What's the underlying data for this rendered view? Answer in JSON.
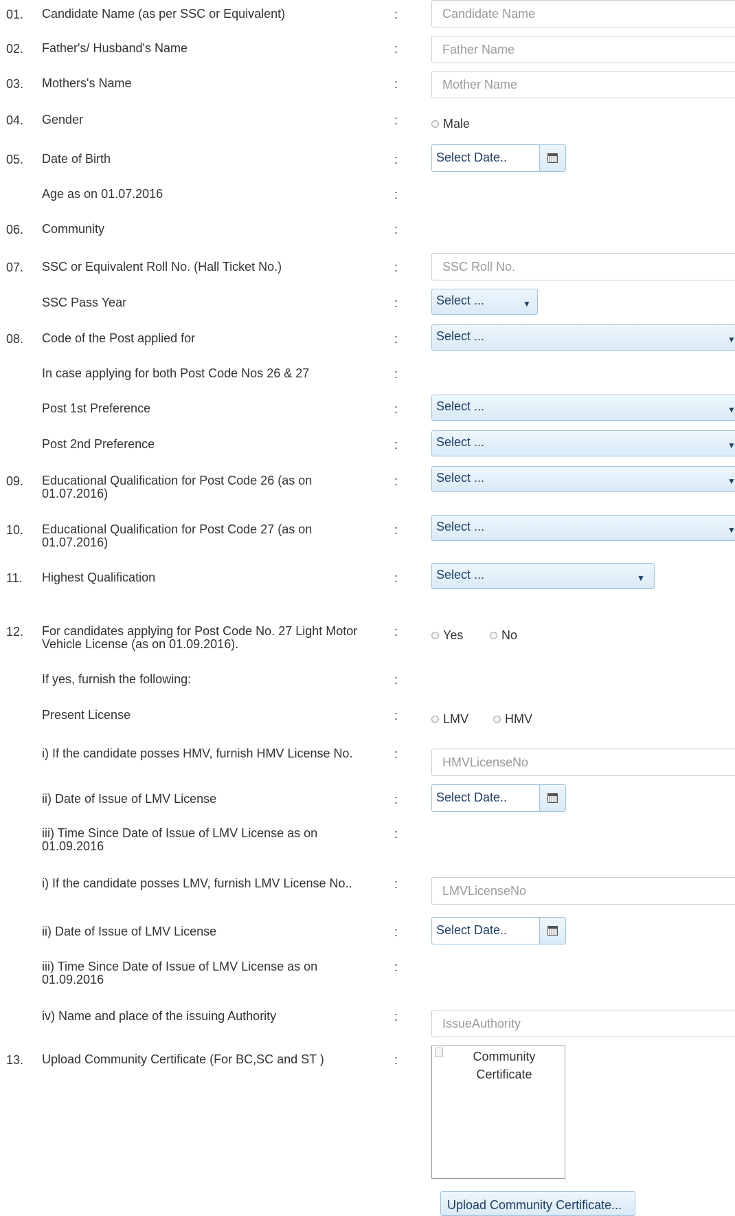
{
  "rows": {
    "r01": {
      "num": "01.",
      "label": "Candidate Name (as per SSC or Equivalent)",
      "placeholder": "Candidate Name"
    },
    "r02": {
      "num": "02.",
      "label": "Father's/ Husband's Name",
      "placeholder": "Father Name"
    },
    "r03": {
      "num": "03.",
      "label": "Mothers's Name",
      "placeholder": "Mother Name"
    },
    "r04": {
      "num": "04.",
      "label": "Gender",
      "option1": "Male"
    },
    "r05": {
      "num": "05.",
      "label": "Date of Birth",
      "value": "Select Date.."
    },
    "age": {
      "label": "Age as on 01.07.2016"
    },
    "r06": {
      "num": "06.",
      "label": "Community"
    },
    "r07": {
      "num": "07.",
      "label": "SSC or Equivalent Roll No. (Hall Ticket No.)",
      "placeholder": "SSC Roll No."
    },
    "ssc_year": {
      "label": "SSC Pass Year",
      "value": "Select ..."
    },
    "r08": {
      "num": "08.",
      "label": "Code of the Post applied for",
      "value": "Select ..."
    },
    "both": {
      "label": "In case applying for both Post Code Nos 26 & 27"
    },
    "pref1": {
      "label": "Post 1st Preference",
      "value": "Select ..."
    },
    "pref2": {
      "label": "Post 2nd Preference",
      "value": "Select ..."
    },
    "r09": {
      "num": "09.",
      "label": "Educational Qualification for Post Code 26 (as on 01.07.2016)",
      "value": "Select ..."
    },
    "r10": {
      "num": "10.",
      "label": "Educational Qualification for Post Code 27 (as on 01.07.2016)",
      "value": "Select ..."
    },
    "r11": {
      "num": "11.",
      "label": "Highest Qualification",
      "value": "Select ..."
    },
    "r12": {
      "num": "12.",
      "label": "For candidates applying for Post Code No. 27 Light Motor Vehicle License (as on 01.09.2016).",
      "option1": "Yes",
      "option2": "No"
    },
    "ifyes": {
      "label": "If yes, furnish the following:"
    },
    "present": {
      "label": "Present License",
      "option1": "LMV",
      "option2": "HMV"
    },
    "hmv_no": {
      "label": "i) If the candidate posses HMV, furnish HMV License No.",
      "placeholder": "HMVLicenseNo"
    },
    "hmv_date": {
      "label": "ii) Date of Issue of LMV License",
      "value": "Select Date.."
    },
    "hmv_time": {
      "label": "iii) Time Since Date of Issue of LMV License as on 01.09.2016"
    },
    "lmv_no": {
      "label": "i) If the candidate posses LMV, furnish LMV License No..",
      "placeholder": "LMVLicenseNo"
    },
    "lmv_date": {
      "label": "ii) Date of Issue of LMV License",
      "value": "Select Date.."
    },
    "lmv_time": {
      "label": "iii) Time Since Date of Issue of LMV License as on 01.09.2016"
    },
    "authority": {
      "label": "iv) Name and place of the issuing Authority",
      "placeholder": "IssueAuthority"
    },
    "r13": {
      "num": "13.",
      "label": "Upload Community Certificate (For BC,SC and ST )",
      "image_alt": "Community Certificate",
      "button": "Upload Community Certificate..."
    }
  },
  "colon": ":"
}
